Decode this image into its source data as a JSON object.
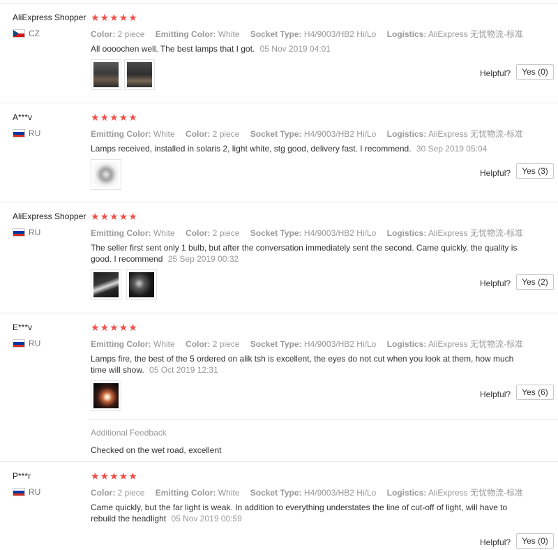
{
  "helpful_label": "Helpful?",
  "colors": {
    "star": "#f04f47",
    "muted": "#999999",
    "text": "#333333"
  },
  "reviews": [
    {
      "user": "AliExpress Shopper",
      "country": "CZ",
      "flag": "czech-flag-icon",
      "stars": "★★★★★",
      "rating": 5,
      "props": [
        {
          "label": "Color:",
          "value": "2 piece"
        },
        {
          "label": "Emitting Color:",
          "value": "White"
        },
        {
          "label": "Socket Type:",
          "value": "H4/9003/HB2 Hi/Lo"
        },
        {
          "label": "Logistics:",
          "value": "AliExpress 无忧物流-标准"
        }
      ],
      "text": "All oooochen well. The best lamps that I got.",
      "date": "05 Nov 2019 04:01",
      "yes": "Yes (0)"
    },
    {
      "user": "A***v",
      "country": "RU",
      "flag": "russia-flag-icon",
      "stars": "★★★★★",
      "rating": 5,
      "props": [
        {
          "label": "Emitting Color:",
          "value": "White"
        },
        {
          "label": "Color:",
          "value": "2 piece"
        },
        {
          "label": "Socket Type:",
          "value": "H4/9003/HB2 Hi/Lo"
        },
        {
          "label": "Logistics:",
          "value": "AliExpress 无忧物流-标准"
        }
      ],
      "text": "Lamps received, installed in solaris 2, light white, stg good, delivery fast. I recommend.",
      "date": "30 Sep 2019 05:04",
      "yes": "Yes (3)"
    },
    {
      "user": "AliExpress Shopper",
      "country": "RU",
      "flag": "russia-flag-icon",
      "stars": "★★★★★",
      "rating": 5,
      "props": [
        {
          "label": "Emitting Color:",
          "value": "White"
        },
        {
          "label": "Color:",
          "value": "2 piece"
        },
        {
          "label": "Socket Type:",
          "value": "H4/9003/HB2 Hi/Lo"
        },
        {
          "label": "Logistics:",
          "value": "AliExpress 无忧物流-标准"
        }
      ],
      "text_line1": "The seller first sent only 1 bulb, but after the conversation immediately sent the second. Came quickly, the quality is",
      "text_line2": "good. I recommend",
      "date": "25 Sep 2019 00:32",
      "yes": "Yes (2)"
    },
    {
      "user": "E***v",
      "country": "RU",
      "flag": "russia-flag-icon",
      "stars": "★★★★★",
      "rating": 5,
      "props": [
        {
          "label": "Emitting Color:",
          "value": "White"
        },
        {
          "label": "Color:",
          "value": "2 piece"
        },
        {
          "label": "Socket Type:",
          "value": "H4/9003/HB2 Hi/Lo"
        },
        {
          "label": "Logistics:",
          "value": "AliExpress 无忧物流-标准"
        }
      ],
      "text_line1": "Lamps fire, the best of the 5 ordered on alik tsh is excellent, the eyes do not cut when you look at them, how much",
      "text_line2": "time will show.",
      "date": "05 Oct 2019 12:31",
      "yes": "Yes (6)",
      "additional_label": "Additional Feedback",
      "additional_text": "Checked on the wet road, excellent"
    },
    {
      "user": "P***r",
      "country": "RU",
      "flag": "russia-flag-icon",
      "stars": "★★★★★",
      "rating": 5,
      "props": [
        {
          "label": "Color:",
          "value": "2 piece"
        },
        {
          "label": "Emitting Color:",
          "value": "White"
        },
        {
          "label": "Socket Type:",
          "value": "H4/9003/HB2 Hi/Lo"
        },
        {
          "label": "Logistics:",
          "value": "AliExpress 无忧物流-标准"
        }
      ],
      "text_line1": "Came quickly, but the far light is weak. In addition to everything understates the line of cut-off of light, will have to",
      "text_line2": "rebuild the headlight",
      "date": "05 Nov 2019 00:59",
      "yes": "Yes (0)"
    }
  ]
}
